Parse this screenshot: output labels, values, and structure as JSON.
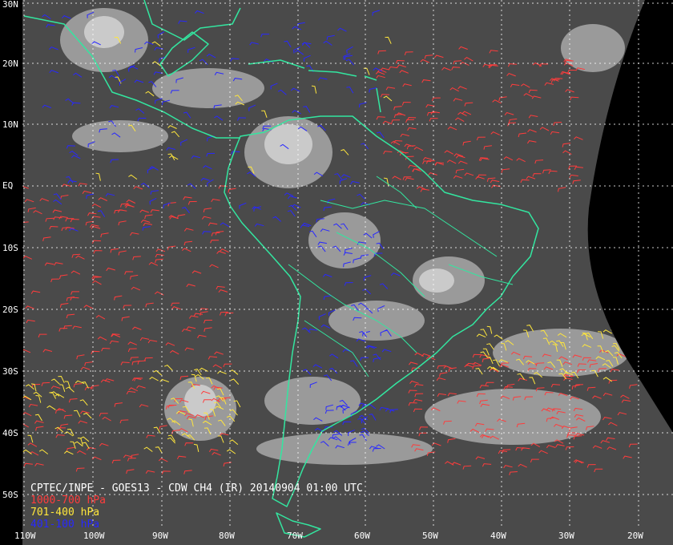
{
  "title": "CPTEC/INPE - GOES13 - CDW CH4 (IR) 20140904 01:00 UTC",
  "legend": [
    {
      "label": "1000-700 hPa",
      "color": "#ff3c3c"
    },
    {
      "label": "701-400 hPa",
      "color": "#ffe63c"
    },
    {
      "label": "401-100 hPa",
      "color": "#2828ff"
    }
  ],
  "lat_labels": [
    "30N",
    "20N",
    "10N",
    "EQ",
    "10S",
    "20S",
    "30S",
    "40S",
    "50S"
  ],
  "lon_labels": [
    "110W",
    "100W",
    "90W",
    "80W",
    "70W",
    "60W",
    "50W",
    "40W",
    "30W",
    "20W"
  ],
  "colors": {
    "background": "#000000",
    "coastline": "#33e6a0",
    "grid": "#ffffff",
    "ocean_ir": "#4a4a4a",
    "cloud": "#e6e6e6"
  }
}
